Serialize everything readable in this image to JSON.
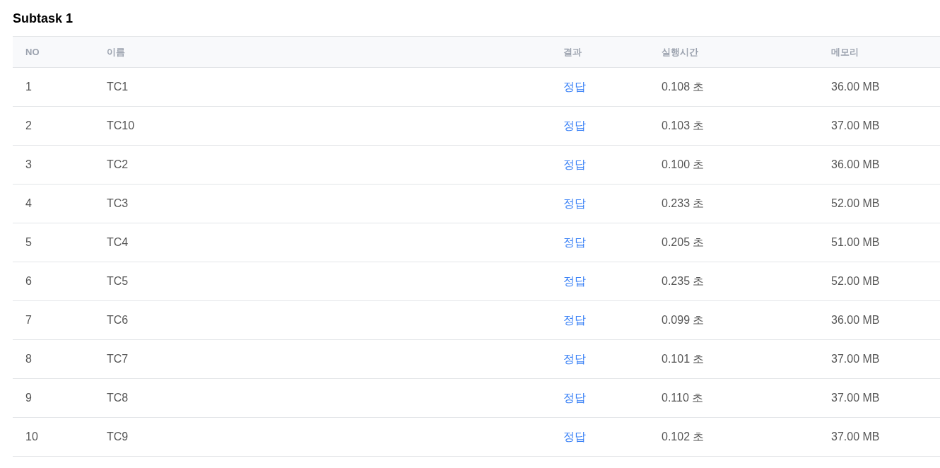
{
  "title": "Subtask 1",
  "table": {
    "columns": [
      "NO",
      "이름",
      "결과",
      "실행시간",
      "메모리"
    ],
    "rows": [
      {
        "no": "1",
        "name": "TC1",
        "result": "정답",
        "color": "#3b82f6",
        "time": "0.108 초",
        "memory": "36.00 MB"
      },
      {
        "no": "2",
        "name": "TC10",
        "result": "정답",
        "color": "#3b82f6",
        "time": "0.103 초",
        "memory": "37.00 MB"
      },
      {
        "no": "3",
        "name": "TC2",
        "result": "정답",
        "color": "#3b82f6",
        "time": "0.100 초",
        "memory": "36.00 MB"
      },
      {
        "no": "4",
        "name": "TC3",
        "result": "정답",
        "color": "#3b82f6",
        "time": "0.233 초",
        "memory": "52.00 MB"
      },
      {
        "no": "5",
        "name": "TC4",
        "result": "정답",
        "color": "#3b82f6",
        "time": "0.205 초",
        "memory": "51.00 MB"
      },
      {
        "no": "6",
        "name": "TC5",
        "result": "정답",
        "color": "#3b82f6",
        "time": "0.235 초",
        "memory": "52.00 MB"
      },
      {
        "no": "7",
        "name": "TC6",
        "result": "정답",
        "color": "#3b82f6",
        "time": "0.099 초",
        "memory": "36.00 MB"
      },
      {
        "no": "8",
        "name": "TC7",
        "result": "정답",
        "color": "#3b82f6",
        "time": "0.101 초",
        "memory": "37.00 MB"
      },
      {
        "no": "9",
        "name": "TC8",
        "result": "정답",
        "color": "#3b82f6",
        "time": "0.110 초",
        "memory": "37.00 MB"
      },
      {
        "no": "10",
        "name": "TC9",
        "result": "정답",
        "color": "#3b82f6",
        "time": "0.102 초",
        "memory": "37.00 MB"
      }
    ]
  }
}
